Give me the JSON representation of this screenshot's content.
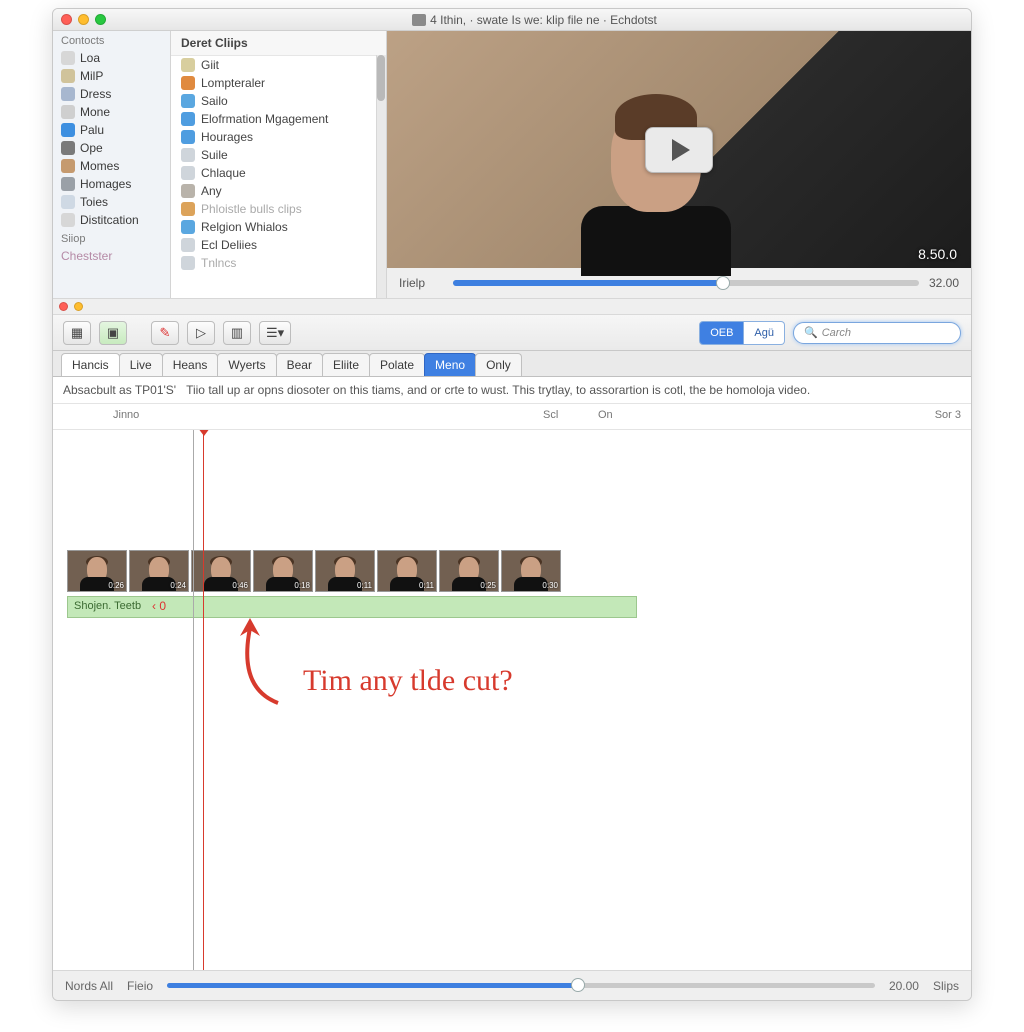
{
  "window": {
    "title": "4 Ithin, · swate  Is we: klip file ne · Echdotst"
  },
  "sidebar": {
    "header": "Contocts",
    "items": [
      {
        "label": "Loa",
        "color": "#d7d7d7"
      },
      {
        "label": "MilP",
        "color": "#d0c39b"
      },
      {
        "label": "Dress",
        "color": "#a7b7cf"
      },
      {
        "label": "Mone",
        "color": "#cfcfcf"
      },
      {
        "label": "Palu",
        "color": "#3d8fe0"
      },
      {
        "label": "Ope",
        "color": "#7a7a7a"
      },
      {
        "label": "Momes",
        "color": "#c59a6f"
      },
      {
        "label": "Homages",
        "color": "#9aa0a7"
      },
      {
        "label": "Toies",
        "color": "#cfd9e4"
      },
      {
        "label": "Distitcation",
        "color": "#d7d7d7"
      }
    ],
    "sec2": "Siiop",
    "sec2item": "Chestster"
  },
  "cliplist": {
    "header": "Deret Cliips",
    "rows": [
      {
        "label": "Giit",
        "color": "#d8ce9e"
      },
      {
        "label": "Lompteraler",
        "color": "#e08a3f"
      },
      {
        "label": "Sailo",
        "color": "#5aa7e0"
      },
      {
        "label": "Elofrmation Mgagement",
        "color": "#4f9de0"
      },
      {
        "label": "Hourages",
        "color": "#4f9de0"
      },
      {
        "label": "Suile",
        "color": "#cfd5db"
      },
      {
        "label": "Chlaque",
        "color": "#cfd5db"
      },
      {
        "label": "Any",
        "color": "#b9b3aa"
      },
      {
        "label": "Phloistle bulls clips",
        "color": "#dca35a",
        "dim": true
      },
      {
        "label": "Relgion Whialos",
        "color": "#5aa7e0"
      },
      {
        "label": "Ecl Deliies",
        "color": "#cfd5db"
      },
      {
        "label": "Tnlncs",
        "color": "#cfd5db",
        "dim": true
      }
    ]
  },
  "preview": {
    "timecode": "8.50.0",
    "scrub_label": "Irielp",
    "duration": "32.00"
  },
  "toolbar": {
    "seg_a": "OEB",
    "seg_b": "Agü",
    "search_placeholder": "Carch"
  },
  "tabs": [
    {
      "label": "Hancis",
      "state": "active"
    },
    {
      "label": "Live",
      "state": ""
    },
    {
      "label": "Heans",
      "state": ""
    },
    {
      "label": "Wyerts",
      "state": ""
    },
    {
      "label": "Bear",
      "state": ""
    },
    {
      "label": "Eliite",
      "state": ""
    },
    {
      "label": "Polate",
      "state": ""
    },
    {
      "label": "Meno",
      "state": "sel"
    },
    {
      "label": "Only",
      "state": ""
    }
  ],
  "infobar": {
    "left": "Absacbult as TP01'S'",
    "right": "Tiio tall up ar opns diosoter on this tiams, and or crte to wust. This trytlay, to assorartion is cotl, the be homoloja video."
  },
  "ruler": {
    "a": "Jinno",
    "b": "Scl",
    "c": "On",
    "d": "Sor 3"
  },
  "thumbs": [
    "0:26",
    "0:24",
    "0:46",
    "0:18",
    "0:11",
    "0:11",
    "0:25",
    "0:30"
  ],
  "audio": {
    "label": "Shojen. Teetb",
    "marker": "‹ 0"
  },
  "annotation": "Tim  any  tlde  cut?",
  "bottom": {
    "left": "Nords All",
    "mid": "Fieio",
    "val": "20.00",
    "right": "Slips"
  }
}
